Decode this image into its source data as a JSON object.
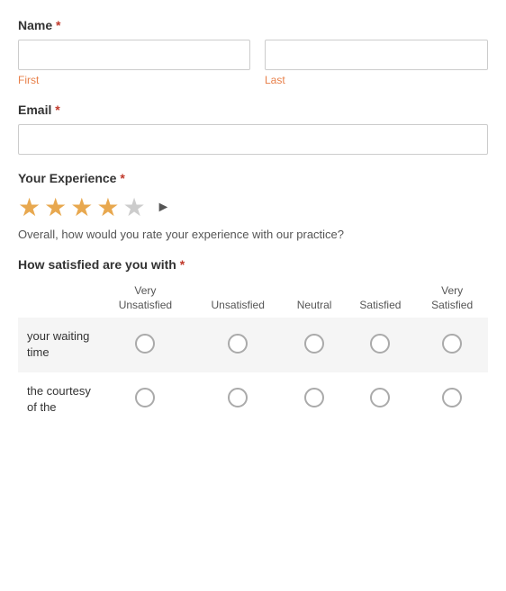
{
  "form": {
    "name_label": "Name",
    "required_marker": "*",
    "first_placeholder": "",
    "last_placeholder": "",
    "first_sub_label": "First",
    "last_sub_label": "Last",
    "email_label": "Email",
    "email_placeholder": "",
    "experience_label": "Your Experience",
    "stars_filled": 4,
    "stars_total": 5,
    "experience_desc": "Overall, how would you rate your experience with our practice?",
    "satisfied_label": "How satisfied are you with",
    "table_headers": [
      {
        "label": "",
        "sub": ""
      },
      {
        "label": "Very",
        "sub": "Unsatisfied"
      },
      {
        "label": "",
        "sub": "Unsatisfied"
      },
      {
        "label": "",
        "sub": "Neutral"
      },
      {
        "label": "",
        "sub": "Satisfied"
      },
      {
        "label": "Very",
        "sub": "Satisfied"
      }
    ],
    "rows": [
      {
        "label": "your waiting time",
        "name": "waiting_time"
      },
      {
        "label": "the courtesy of the",
        "name": "courtesy"
      }
    ]
  }
}
